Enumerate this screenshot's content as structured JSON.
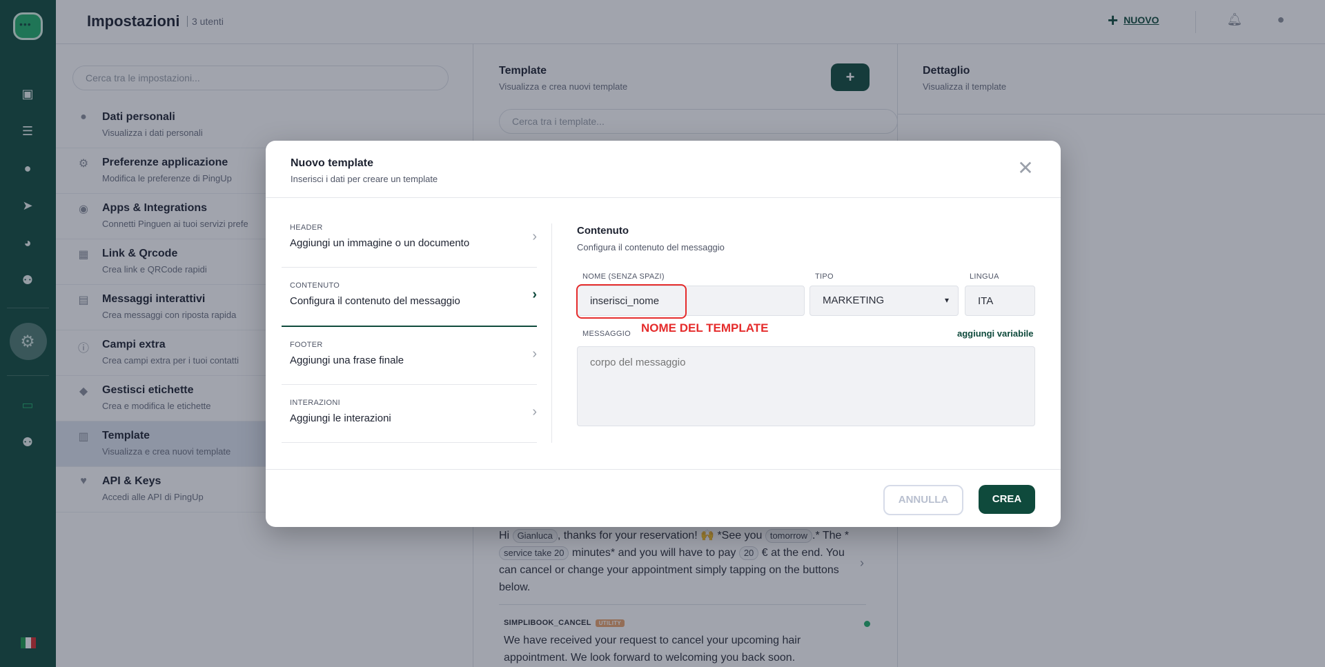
{
  "colors": {
    "brand": "#0f4a3c",
    "accent": "#1fae6a",
    "highlight": "#e52b2b",
    "badge": "#e9a36b"
  },
  "header": {
    "title": "Impostazioni",
    "users_count": "3 utenti",
    "new_label": "NUOVO"
  },
  "rail": {
    "icons": [
      "chat-icon",
      "inbox-icon",
      "contact-icon",
      "send-icon",
      "chart-icon",
      "group-icon",
      "settings-icon",
      "bot-icon",
      "team-icon"
    ],
    "flag": "italy-flag"
  },
  "settings": {
    "search_placeholder": "Cerca tra le impostazioni...",
    "items": [
      {
        "title": "Dati personali",
        "subtitle": "Visualizza i dati personali",
        "icon": "user-icon"
      },
      {
        "title": "Preferenze applicazione",
        "subtitle": "Modifica le preferenze di PingUp",
        "icon": "gear-icon"
      },
      {
        "title": "Apps & Integrations",
        "subtitle": "Connetti Pinguen ai tuoi servizi prefe",
        "icon": "apps-icon"
      },
      {
        "title": "Link & Qrcode",
        "subtitle": "Crea link e QRCode rapidi",
        "icon": "qrcode-icon"
      },
      {
        "title": "Messaggi interattivi",
        "subtitle": "Crea messaggi con riposta rapida",
        "icon": "message-icon"
      },
      {
        "title": "Campi extra",
        "subtitle": "Crea campi extra per i tuoi contatti",
        "icon": "info-icon"
      },
      {
        "title": "Gestisci etichette",
        "subtitle": "Crea e modifica le etichette",
        "icon": "tag-icon"
      },
      {
        "title": "Template",
        "subtitle": "Visualizza e crea nuovi template",
        "icon": "template-icon"
      },
      {
        "title": "API & Keys",
        "subtitle": "Accedi alle API di PingUp",
        "icon": "heart-icon"
      }
    ]
  },
  "templates": {
    "title": "Template",
    "subtitle": "Visualizza e crea nuovi template",
    "add_label": "+",
    "search_placeholder": "Cerca tra i template...",
    "card1": {
      "p1": "Hi",
      "chip_name": "Gianluca",
      "p2": ", thanks for your reservation! 🙌 *See you",
      "chip_date": "tomorrow",
      "p3": ".* The *",
      "chip_service": "service take 20",
      "p4": "minutes* and you will have to pay",
      "chip_price": "20",
      "p5": "€ at the end. You can cancel or change your appointment simply tapping on the buttons below."
    },
    "card2": {
      "name": "SIMPLIBOOK_CANCEL",
      "badge": "UTILITY",
      "body": "We have received your request to cancel your upcoming hair appointment. We look forward to welcoming you back soon."
    }
  },
  "detail": {
    "title": "Dettaglio",
    "subtitle": "Visualizza il template"
  },
  "modal": {
    "title": "Nuovo template",
    "subtitle": "Inserisci i dati per creare un template",
    "steps": [
      {
        "key": "HEADER",
        "value": "Aggiungi un immagine o un documento"
      },
      {
        "key": "CONTENUTO",
        "value": "Configura il contenuto del messaggio"
      },
      {
        "key": "FOOTER",
        "value": "Aggiungi una frase finale"
      },
      {
        "key": "INTERAZIONI",
        "value": "Aggiungi le interazioni"
      }
    ],
    "content": {
      "title": "Contenuto",
      "subtitle": "Configura il contenuto del messaggio",
      "name_label": "NOME (SENZA SPAZI)",
      "name_value": "inserisci_nome",
      "tipo_label": "TIPO",
      "tipo_value": "MARKETING",
      "lingua_label": "LINGUA",
      "lingua_value": "ITA",
      "annotation": "NOME DEL TEMPLATE",
      "messaggio_label": "MESSAGGIO",
      "add_variable": "aggiungi variabile",
      "message_placeholder": "corpo del messaggio"
    },
    "cancel_label": "ANNULLA",
    "create_label": "CREA"
  }
}
